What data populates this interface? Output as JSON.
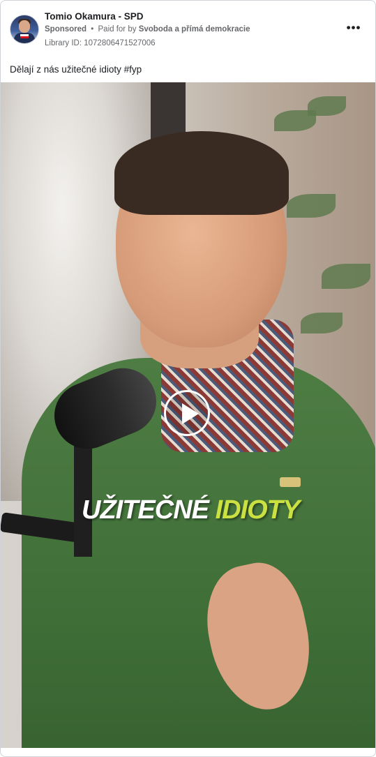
{
  "post": {
    "page_name": "Tomio Okamura - SPD",
    "sponsored_label": "Sponsored",
    "separator": "•",
    "paid_prefix": "Paid for by",
    "payer": "Svoboda a přímá demokracie",
    "library_id": "Library ID: 1072806471527006",
    "more_icon": "•••",
    "caption": "Dělají z nás užitečné idioty #fyp"
  },
  "video": {
    "overlay_word_1": "UŽITEČNÉ",
    "overlay_word_2": "IDIOTY",
    "overlay_color_1": "#ffffff",
    "overlay_color_2": "#cbe142",
    "play_icon": "play-icon"
  }
}
